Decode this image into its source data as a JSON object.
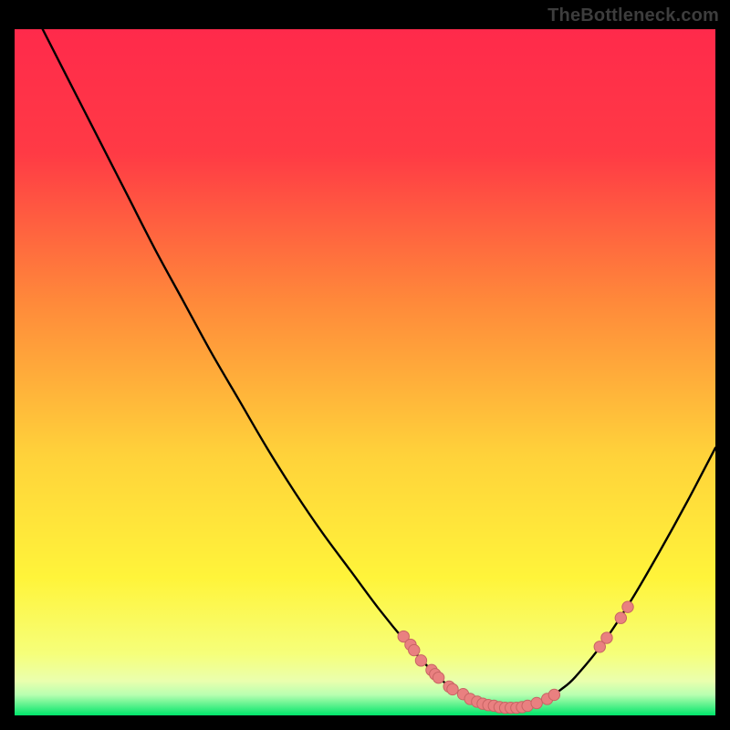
{
  "attribution": "TheBottleneck.com",
  "colors": {
    "gradient_top": "#ff2a4b",
    "gradient_mid_upper": "#ff6a3a",
    "gradient_mid": "#ffd23a",
    "gradient_mid_lower": "#f7ff3a",
    "gradient_bottom_band": "#f0ff8a",
    "gradient_bottom": "#00e56a",
    "curve": "#000000",
    "marker_fill": "#e98080",
    "marker_stroke": "#c86464",
    "background": "#000000"
  },
  "chart_data": {
    "type": "line",
    "title": "",
    "xlabel": "",
    "ylabel": "",
    "xlim": [
      0,
      100
    ],
    "ylim": [
      0,
      100
    ],
    "grid": false,
    "legend": false,
    "series": [
      {
        "name": "bottleneck-curve",
        "x": [
          0,
          4,
          8,
          12,
          16,
          20,
          24,
          28,
          32,
          36,
          40,
          44,
          48,
          52,
          56,
          60,
          62,
          64,
          66,
          68,
          70,
          72,
          74,
          76,
          78,
          80,
          84,
          88,
          92,
          96,
          100
        ],
        "y": [
          108,
          100,
          92,
          84,
          76,
          68,
          60.5,
          53,
          46,
          39,
          32.5,
          26.5,
          21,
          15.5,
          10.5,
          6,
          4.3,
          3,
          2,
          1.4,
          1.1,
          1.1,
          1.5,
          2.4,
          3.8,
          5.6,
          10.6,
          16.8,
          23.8,
          31.2,
          39
        ]
      }
    ],
    "markers": [
      {
        "name": "left-cluster",
        "points": [
          {
            "x": 55.5,
            "y": 11.5
          },
          {
            "x": 56.5,
            "y": 10.3
          },
          {
            "x": 57.0,
            "y": 9.5
          },
          {
            "x": 58.0,
            "y": 8.0
          },
          {
            "x": 59.5,
            "y": 6.6
          },
          {
            "x": 60.0,
            "y": 6.0
          },
          {
            "x": 60.5,
            "y": 5.5
          },
          {
            "x": 62.0,
            "y": 4.2
          },
          {
            "x": 62.5,
            "y": 3.8
          }
        ]
      },
      {
        "name": "valley-cluster",
        "points": [
          {
            "x": 64.0,
            "y": 3.1
          },
          {
            "x": 65.0,
            "y": 2.4
          },
          {
            "x": 66.0,
            "y": 2.0
          },
          {
            "x": 66.8,
            "y": 1.7
          },
          {
            "x": 67.6,
            "y": 1.5
          },
          {
            "x": 68.4,
            "y": 1.4
          },
          {
            "x": 69.2,
            "y": 1.2
          },
          {
            "x": 70.0,
            "y": 1.1
          },
          {
            "x": 70.8,
            "y": 1.1
          },
          {
            "x": 71.6,
            "y": 1.1
          },
          {
            "x": 72.4,
            "y": 1.2
          },
          {
            "x": 73.2,
            "y": 1.4
          },
          {
            "x": 74.5,
            "y": 1.8
          },
          {
            "x": 76.0,
            "y": 2.4
          },
          {
            "x": 77.0,
            "y": 3.0
          }
        ]
      },
      {
        "name": "right-cluster",
        "points": [
          {
            "x": 83.5,
            "y": 10.0
          },
          {
            "x": 84.5,
            "y": 11.3
          },
          {
            "x": 86.5,
            "y": 14.2
          },
          {
            "x": 87.5,
            "y": 15.8
          }
        ]
      }
    ]
  }
}
